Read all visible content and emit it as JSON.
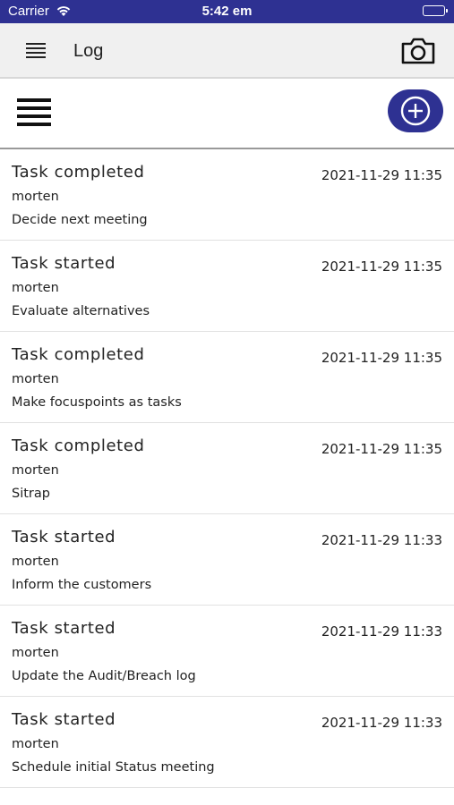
{
  "status_bar": {
    "carrier": "Carrier",
    "time": "5:42 em",
    "color": "#2e3192"
  },
  "navbar": {
    "title": "Log",
    "left_icon": "hamburger-menu-icon",
    "right_icon": "camera-icon"
  },
  "toolbar": {
    "left_icon": "list-icon",
    "add_icon": "plus-circle-icon",
    "accent": "#2e3192"
  },
  "log_entries": [
    {
      "event": "Task completed",
      "user": "morten",
      "task": "Decide next meeting",
      "timestamp": "2021-11-29 11:35"
    },
    {
      "event": "Task started",
      "user": "morten",
      "task": "Evaluate alternatives",
      "timestamp": "2021-11-29 11:35"
    },
    {
      "event": "Task completed",
      "user": "morten",
      "task": "Make focuspoints as tasks",
      "timestamp": "2021-11-29 11:35"
    },
    {
      "event": "Task completed",
      "user": "morten",
      "task": "Sitrap",
      "timestamp": "2021-11-29 11:35"
    },
    {
      "event": "Task started",
      "user": "morten",
      "task": "Inform the customers",
      "timestamp": "2021-11-29 11:33"
    },
    {
      "event": "Task started",
      "user": "morten",
      "task": "Update the Audit/Breach log",
      "timestamp": "2021-11-29 11:33"
    },
    {
      "event": "Task started",
      "user": "morten",
      "task": "Schedule initial Status meeting",
      "timestamp": "2021-11-29 11:33"
    }
  ]
}
